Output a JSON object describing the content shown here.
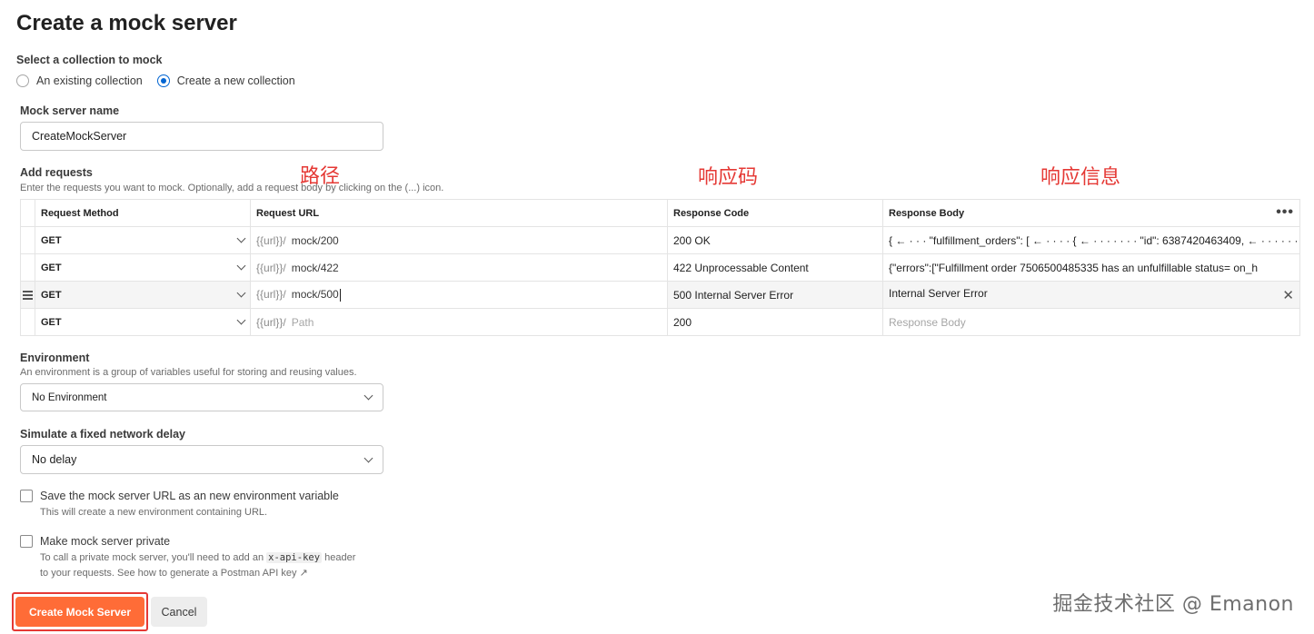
{
  "page": {
    "title": "Create a mock server"
  },
  "collection": {
    "label": "Select a collection to mock",
    "options": [
      {
        "label": "An existing collection",
        "checked": false
      },
      {
        "label": "Create a new collection",
        "checked": true
      }
    ]
  },
  "mock_name": {
    "label": "Mock server name",
    "value": "CreateMockServer"
  },
  "requests": {
    "label": "Add requests",
    "helper": "Enter the requests you want to mock. Optionally, add a request body by clicking on the (...) icon.",
    "headers": [
      "Request Method",
      "Request URL",
      "Response Code",
      "Response Body"
    ],
    "url_prefix": "{{url}}/",
    "rows": [
      {
        "method": "GET",
        "path": "mock/200",
        "code": "200 OK",
        "body": "{ ← · · · \"fulfillment_orders\": [ ← · · · · { ← · · · · · · · \"id\": 6387420463409, ← · · · · · · · \"s"
      },
      {
        "method": "GET",
        "path": "mock/422",
        "code": "422 Unprocessable Content",
        "body": "{\"errors\":[\"Fulfillment order 7506500485335 has an unfulfillable status= on_h"
      },
      {
        "method": "GET",
        "path": "mock/500",
        "code": "500 Internal Server Error",
        "body": "Internal Server Error"
      },
      {
        "method": "GET",
        "path_placeholder": "Path",
        "code": "200",
        "body_placeholder": "Response Body"
      }
    ]
  },
  "annotations": {
    "path": "路径",
    "code": "响应码",
    "body": "响应信息"
  },
  "environment": {
    "label": "Environment",
    "helper": "An environment is a group of variables useful for storing and reusing values.",
    "value": "No Environment"
  },
  "delay": {
    "label": "Simulate a fixed network delay",
    "value": "No delay"
  },
  "save_env": {
    "label": "Save the mock server URL as an new environment variable",
    "helper": "This will create a new environment containing URL."
  },
  "private": {
    "label": "Make mock server private",
    "helper_pre": "To call a private mock server, you'll need to add an",
    "helper_code": "x-api-key",
    "helper_post": "header",
    "helper_line2": "to your requests. See how to generate a Postman API key ↗"
  },
  "buttons": {
    "create": "Create Mock Server",
    "cancel": "Cancel"
  },
  "watermark": "掘金技术社区 @ Emanon",
  "colors": {
    "accent": "#ff6c37",
    "radio": "#0265d2",
    "annotation": "#e53935"
  }
}
